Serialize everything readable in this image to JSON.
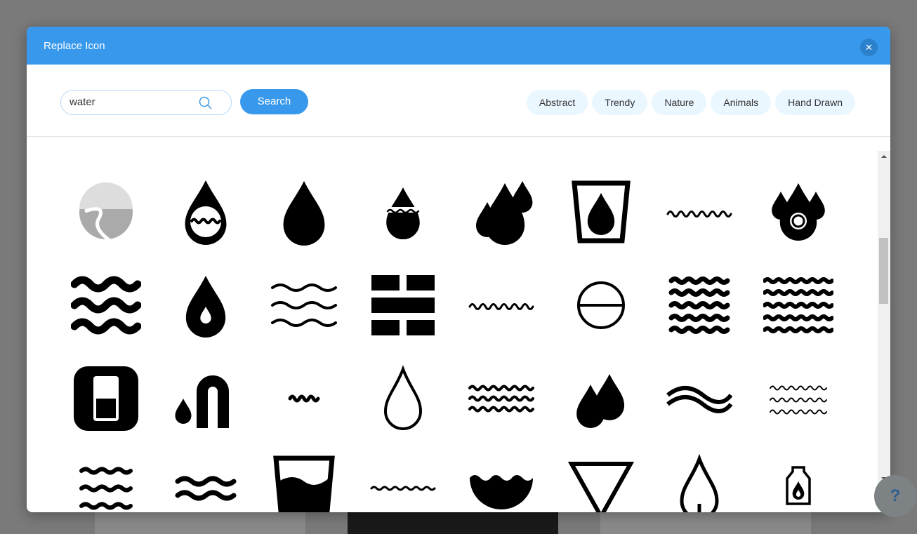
{
  "modal": {
    "title": "Replace Icon",
    "close_label": "X"
  },
  "search": {
    "value": "water",
    "button_label": "Search"
  },
  "tags": [
    "Abstract",
    "Trendy",
    "Nature",
    "Animals",
    "Hand Drawn"
  ],
  "icons": [
    "river-landscape-icon",
    "drop-in-circle-waves-icon",
    "water-drop-icon",
    "drop-half-filled-icon",
    "three-drops-icon",
    "glass-with-drop-icon",
    "wave-line-icon",
    "drops-with-bubbles-icon",
    "thick-waves-icon",
    "drop-with-inner-drop-icon",
    "three-wave-lines-icon",
    "brick-wall-icon",
    "wave-line-small-icon",
    "circle-divided-icon",
    "stacked-waves-icon",
    "stacked-waves-wide-icon",
    "water-glass-app-icon",
    "faucet-drop-icon",
    "small-wave-icon",
    "drop-outline-icon",
    "zigzag-waves-icon",
    "two-drops-icon",
    "swoosh-waves-icon",
    "outline-waves-icon",
    "three-waves-icon",
    "two-waves-icon",
    "cup-water-icon",
    "thin-wave-icon",
    "bowl-waves-icon",
    "triangle-down-icon",
    "drop-outline-stem-icon",
    "bottle-drop-icon"
  ],
  "help_label": "?"
}
